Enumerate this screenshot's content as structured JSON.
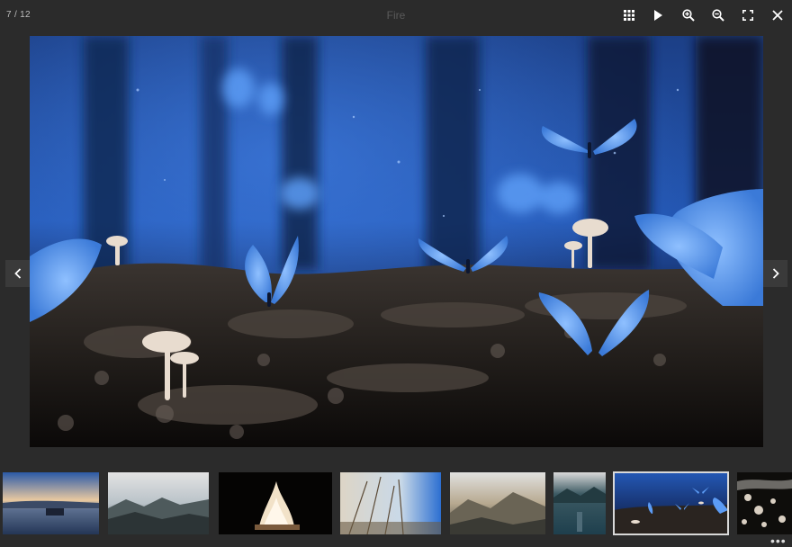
{
  "viewer": {
    "counter": "7 / 12",
    "title": "Fire",
    "more_indicator": "•••"
  },
  "toolbar": [
    {
      "name": "grid-view-button",
      "icon": "grid-icon"
    },
    {
      "name": "slideshow-play-button",
      "icon": "play-icon"
    },
    {
      "name": "zoom-in-button",
      "icon": "zoom-in-icon"
    },
    {
      "name": "zoom-out-button",
      "icon": "zoom-out-icon"
    },
    {
      "name": "fullscreen-button",
      "icon": "fullscreen-icon"
    },
    {
      "name": "close-button",
      "icon": "close-icon"
    }
  ],
  "navigation": {
    "prev_icon": "chevron-left-icon",
    "next_icon": "chevron-right-icon"
  },
  "thumbnails": {
    "count_visible": 8,
    "active_index": 6
  },
  "colors": {
    "background": "#2b2b2b",
    "icon": "#ffffff",
    "active_border": "#d9d9d9",
    "butterfly_blue": "#4f8fe8"
  }
}
